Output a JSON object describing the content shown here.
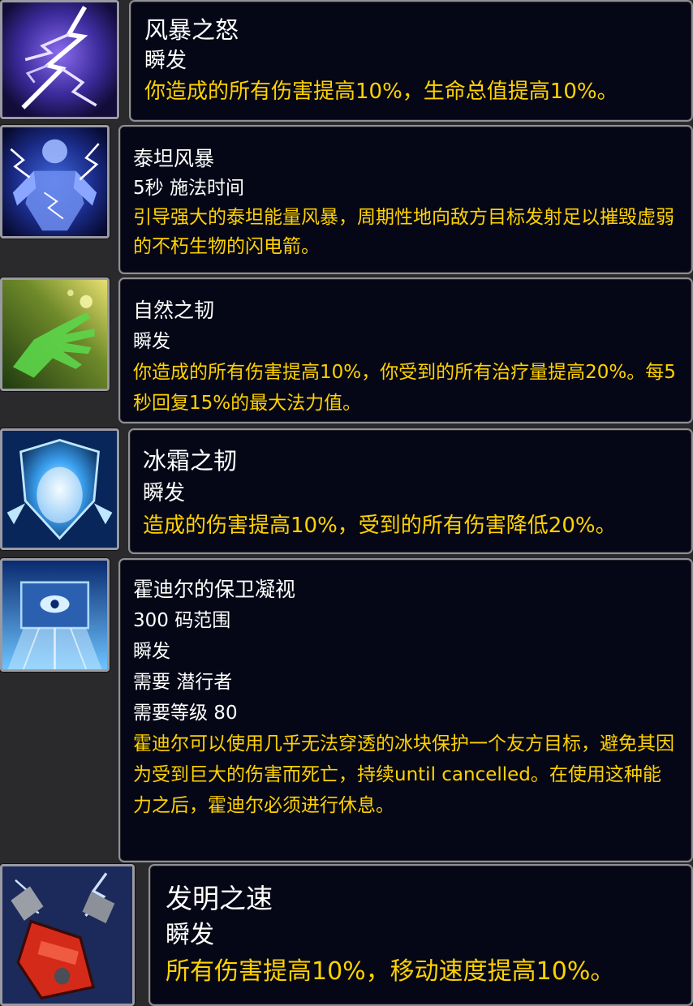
{
  "abilities": [
    {
      "icon": "lightning-icon",
      "name": "风暴之怒",
      "lines": [
        "瞬发"
      ],
      "description": "你造成的所有伤害提高10%，生命总值提高10%。"
    },
    {
      "icon": "titan-storm-icon",
      "name": "泰坦风暴",
      "lines": [
        "5秒 施法时间"
      ],
      "description": "引导强大的泰坦能量风暴，周期性地向敌方目标发射足以摧毁虚弱的不朽生物的闪电箭。"
    },
    {
      "icon": "nature-hand-icon",
      "name": "自然之韧",
      "lines": [
        "瞬发"
      ],
      "description": "你造成的所有伤害提高10%，你受到的所有治疗量提高20%。每5秒回复15%的最大法力值。"
    },
    {
      "icon": "frost-shield-icon",
      "name": "冰霜之韧",
      "lines": [
        "瞬发"
      ],
      "description": "造成的伤害提高10%，受到的所有伤害降低20%。"
    },
    {
      "icon": "ice-block-icon",
      "name": "霍迪尔的保卫凝视",
      "lines": [
        "300 码范围",
        "瞬发",
        "需要 潜行者",
        "需要等级 80"
      ],
      "description": "霍迪尔可以使用几乎无法穿透的冰块保护一个友方目标，避免其因为受到巨大的伤害而死亡，持续until cancelled。在使用这种能力之后，霍迪尔必须进行休息。"
    },
    {
      "icon": "wrench-icon",
      "name": "发明之速",
      "lines": [
        "瞬发"
      ],
      "description": "所有伤害提高10%，移动速度提高10%。"
    }
  ],
  "colors": {
    "panel_background": "#050716",
    "panel_border": "#8f8f95",
    "name_text": "#ffffff",
    "description_text": "#ffd200",
    "page_background": "#2a2a2c"
  }
}
